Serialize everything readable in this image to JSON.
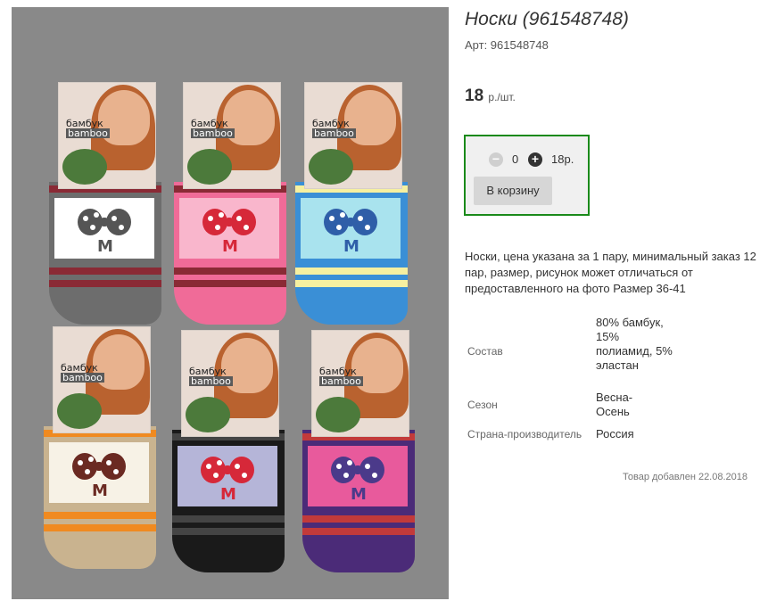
{
  "product": {
    "title": "Носки (961548748)",
    "article": "Арт: 961548748",
    "price_value": "18",
    "price_unit": "р./шт."
  },
  "buy_box": {
    "quantity": "0",
    "sum": "18р.",
    "minus_icon": "minus-circle-icon",
    "plus_icon": "plus-circle-icon",
    "cart_button_label": "В корзину",
    "border_color": "#1a8a1a"
  },
  "description": "Носки, цена указана за 1 пару, минимальный заказ 12 пар, размер, рисунок может отличаться от предоставленного на фото Размер 36-41",
  "properties": [
    {
      "label": "Состав",
      "value": "80% бамбук, 15% полиамид, 5% эластан"
    },
    {
      "label": "Сезон",
      "value": "Весна-Осень"
    },
    {
      "label": "Страна-производитель",
      "value": "Россия"
    }
  ],
  "added_text": "Товар добавлен 22.08.2018",
  "photo": {
    "package_text_1": "бамбук",
    "package_text_2": "bamboo",
    "sock_letter": "M",
    "socks": [
      {
        "color": "#6d6d6d",
        "panel": "#ffffff",
        "bow": "#555555",
        "accent": "#8a2a35"
      },
      {
        "color": "#f06b98",
        "panel": "#f9b6cc",
        "bow": "#d62839",
        "accent": "#8a2a35"
      },
      {
        "color": "#3a8fd6",
        "panel": "#a9e3ee",
        "bow": "#2f5ea8",
        "accent": "#f6f0a0"
      },
      {
        "color": "#c9b38f",
        "panel": "#f7f2e6",
        "bow": "#6b2a22",
        "accent": "#f08a20"
      },
      {
        "color": "#1a1a1a",
        "panel": "#b5b5d8",
        "bow": "#d62839",
        "accent": "#444444"
      },
      {
        "color": "#4b2b78",
        "panel": "#e85a9c",
        "bow": "#4b3a8a",
        "accent": "#c23a3a"
      }
    ]
  }
}
